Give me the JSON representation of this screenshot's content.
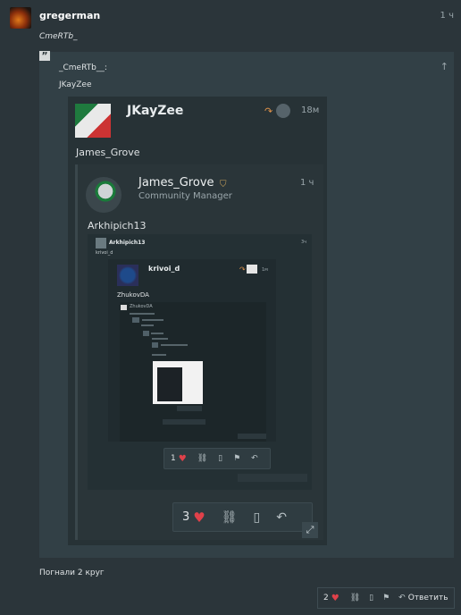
{
  "post": {
    "author": "gregerman",
    "time": "1 ч",
    "message": "CmeRTb_",
    "quote": {
      "header": "_CmeRTb__:",
      "text": "JKayZee",
      "expand_icon": "expand-icon",
      "collapse_icon": "arrow-up-icon"
    },
    "body_text": "Погнали 2 круг",
    "actions": {
      "like_count": "2",
      "reply_label": "Ответить"
    }
  },
  "screenshot": {
    "author": "JKayZee",
    "time": "18м",
    "text": "James_Grove",
    "nested": {
      "author": "James_Grove",
      "role": "Community Manager",
      "time": "1 ч",
      "text": "Arkhipich13",
      "nested": {
        "author": "Arkhipich13",
        "time": "3ч",
        "text": "krivoi_d",
        "nested": {
          "author": "krivoi_d",
          "time": "1м",
          "text": "ZhukovDA",
          "deep_author": "ZhukovDA",
          "like_count": "1"
        }
      }
    },
    "like_count": "3"
  },
  "colors": {
    "background": "#2b353a",
    "heart": "#e0414a",
    "reply_arrow": "#e0924a"
  }
}
